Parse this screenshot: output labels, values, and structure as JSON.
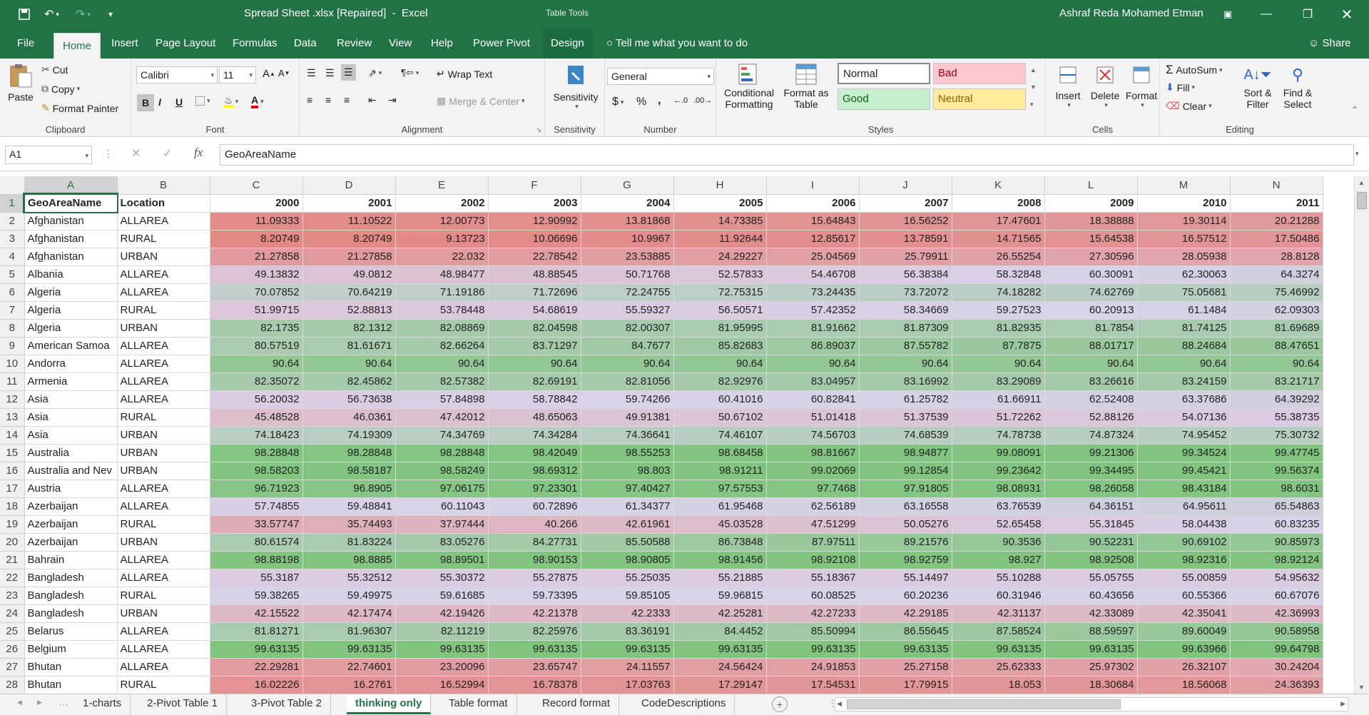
{
  "window": {
    "title": "Spread Sheet .xlsx [Repaired]  -  Excel",
    "contextual_label": "Table Tools",
    "user": "Ashraf Reda Mohamed Etman",
    "share": "Share",
    "tell_me": "Tell me what you want to do"
  },
  "ribbon_tabs": [
    "File",
    "Home",
    "Insert",
    "Page Layout",
    "Formulas",
    "Data",
    "Review",
    "View",
    "Help",
    "Power Pivot",
    "Design"
  ],
  "ribbon": {
    "clipboard": {
      "paste": "Paste",
      "cut": "Cut",
      "copy": "Copy",
      "format_painter": "Format Painter",
      "label": "Clipboard"
    },
    "font": {
      "name": "Calibri",
      "size": "11",
      "label": "Font",
      "bold": "B",
      "italic": "I",
      "underline": "U"
    },
    "alignment": {
      "wrap": "Wrap Text",
      "merge": "Merge & Center",
      "label": "Alignment"
    },
    "sensitivity": {
      "button": "Sensitivity",
      "label": "Sensitivity"
    },
    "number": {
      "format": "General",
      "label": "Number"
    },
    "styles": {
      "conditional": [
        "Conditional",
        "Formatting"
      ],
      "format_table": [
        "Format as",
        "Table"
      ],
      "normal": "Normal",
      "bad": "Bad",
      "good": "Good",
      "neutral": "Neutral",
      "label": "Styles"
    },
    "cells": {
      "insert": "Insert",
      "delete": "Delete",
      "format": "Format",
      "label": "Cells"
    },
    "editing": {
      "autosum": "AutoSum",
      "fill": "Fill",
      "clear": "Clear",
      "sort": [
        "Sort &",
        "Filter"
      ],
      "find": [
        "Find &",
        "Select"
      ],
      "label": "Editing"
    }
  },
  "formula_bar": {
    "name_box": "A1",
    "fx": "fx",
    "content": "GeoAreaName"
  },
  "columns": [
    "A",
    "B",
    "C",
    "D",
    "E",
    "F",
    "G",
    "H",
    "I",
    "J",
    "K",
    "L",
    "M",
    "N"
  ],
  "header_row": [
    "GeoAreaName",
    "Location",
    "2000",
    "2001",
    "2002",
    "2003",
    "2004",
    "2005",
    "2006",
    "2007",
    "2008",
    "2009",
    "2010",
    "2011"
  ],
  "rows": [
    [
      "Afghanistan",
      "ALLAREA",
      "11.09333",
      "11.10522",
      "12.00773",
      "12.90992",
      "13.81868",
      "14.73385",
      "15.64843",
      "16.56252",
      "17.47601",
      "18.38888",
      "19.30114",
      "20.21288"
    ],
    [
      "Afghanistan",
      "RURAL",
      "8.20749",
      "8.20749",
      "9.13723",
      "10.06696",
      "10.9967",
      "11.92644",
      "12.85617",
      "13.78591",
      "14.71565",
      "15.64538",
      "16.57512",
      "17.50486"
    ],
    [
      "Afghanistan",
      "URBAN",
      "21.27858",
      "21.27858",
      "22.032",
      "22.78542",
      "23.53885",
      "24.29227",
      "25.04569",
      "25.79911",
      "26.55254",
      "27.30596",
      "28.05938",
      "28.8128"
    ],
    [
      "Albania",
      "ALLAREA",
      "49.13832",
      "49.0812",
      "48.98477",
      "48.88545",
      "50.71768",
      "52.57833",
      "54.46708",
      "56.38384",
      "58.32848",
      "60.30091",
      "62.30063",
      "64.3274"
    ],
    [
      "Algeria",
      "ALLAREA",
      "70.07852",
      "70.64219",
      "71.19186",
      "71.72696",
      "72.24755",
      "72.75315",
      "73.24435",
      "73.72072",
      "74.18282",
      "74.62769",
      "75.05681",
      "75.46992"
    ],
    [
      "Algeria",
      "RURAL",
      "51.99715",
      "52.88813",
      "53.78448",
      "54.68619",
      "55.59327",
      "56.50571",
      "57.42352",
      "58.34669",
      "59.27523",
      "60.20913",
      "61.1484",
      "62.09303"
    ],
    [
      "Algeria",
      "URBAN",
      "82.1735",
      "82.1312",
      "82.08869",
      "82.04598",
      "82.00307",
      "81.95995",
      "81.91662",
      "81.87309",
      "81.82935",
      "81.7854",
      "81.74125",
      "81.69689"
    ],
    [
      "American Samoa",
      "ALLAREA",
      "80.57519",
      "81.61671",
      "82.66264",
      "83.71297",
      "84.7677",
      "85.82683",
      "86.89037",
      "87.55782",
      "87.7875",
      "88.01717",
      "88.24684",
      "88.47651"
    ],
    [
      "Andorra",
      "ALLAREA",
      "90.64",
      "90.64",
      "90.64",
      "90.64",
      "90.64",
      "90.64",
      "90.64",
      "90.64",
      "90.64",
      "90.64",
      "90.64",
      "90.64"
    ],
    [
      "Armenia",
      "ALLAREA",
      "82.35072",
      "82.45862",
      "82.57382",
      "82.69191",
      "82.81056",
      "82.92976",
      "83.04957",
      "83.16992",
      "83.29089",
      "83.26616",
      "83.24159",
      "83.21717"
    ],
    [
      "Asia",
      "ALLAREA",
      "56.20032",
      "56.73638",
      "57.84898",
      "58.78842",
      "59.74266",
      "60.41016",
      "60.82841",
      "61.25782",
      "61.66911",
      "62.52408",
      "63.37686",
      "64.39292"
    ],
    [
      "Asia",
      "RURAL",
      "45.48528",
      "46.0361",
      "47.42012",
      "48.65063",
      "49.91381",
      "50.67102",
      "51.01418",
      "51.37539",
      "51.72262",
      "52.88126",
      "54.07136",
      "55.38735"
    ],
    [
      "Asia",
      "URBAN",
      "74.18423",
      "74.19309",
      "74.34769",
      "74.34284",
      "74.36641",
      "74.46107",
      "74.56703",
      "74.68539",
      "74.78738",
      "74.87324",
      "74.95452",
      "75.30732"
    ],
    [
      "Australia",
      "URBAN",
      "98.28848",
      "98.28848",
      "98.28848",
      "98.42049",
      "98.55253",
      "98.68458",
      "98.81667",
      "98.94877",
      "99.08091",
      "99.21306",
      "99.34524",
      "99.47745"
    ],
    [
      "Australia and Nev",
      "URBAN",
      "98.58203",
      "98.58187",
      "98.58249",
      "98.69312",
      "98.803",
      "98.91211",
      "99.02069",
      "99.12854",
      "99.23642",
      "99.34495",
      "99.45421",
      "99.56374"
    ],
    [
      "Austria",
      "ALLAREA",
      "96.71923",
      "96.8905",
      "97.06175",
      "97.23301",
      "97.40427",
      "97.57553",
      "97.7468",
      "97.91805",
      "98.08931",
      "98.26058",
      "98.43184",
      "98.6031"
    ],
    [
      "Azerbaijan",
      "ALLAREA",
      "57.74855",
      "59.48841",
      "60.11043",
      "60.72896",
      "61.34377",
      "61.95468",
      "62.56189",
      "63.16558",
      "63.76539",
      "64.36151",
      "64.95611",
      "65.54863"
    ],
    [
      "Azerbaijan",
      "RURAL",
      "33.57747",
      "35.74493",
      "37.97444",
      "40.266",
      "42.61961",
      "45.03528",
      "47.51299",
      "50.05276",
      "52.65458",
      "55.31845",
      "58.04438",
      "60.83235"
    ],
    [
      "Azerbaijan",
      "URBAN",
      "80.61574",
      "81.83224",
      "83.05276",
      "84.27731",
      "85.50588",
      "86.73848",
      "87.97511",
      "89.21576",
      "90.3536",
      "90.52231",
      "90.69102",
      "90.85973"
    ],
    [
      "Bahrain",
      "ALLAREA",
      "98.88198",
      "98.8885",
      "98.89501",
      "98.90153",
      "98.90805",
      "98.91456",
      "98.92108",
      "98.92759",
      "98.927",
      "98.92508",
      "98.92316",
      "98.92124"
    ],
    [
      "Bangladesh",
      "ALLAREA",
      "55.3187",
      "55.32512",
      "55.30372",
      "55.27875",
      "55.25035",
      "55.21885",
      "55.18367",
      "55.14497",
      "55.10288",
      "55.05755",
      "55.00859",
      "54.95632"
    ],
    [
      "Bangladesh",
      "RURAL",
      "59.38265",
      "59.49975",
      "59.61685",
      "59.73395",
      "59.85105",
      "59.96815",
      "60.08525",
      "60.20236",
      "60.31946",
      "60.43656",
      "60.55366",
      "60.67076"
    ],
    [
      "Bangladesh",
      "URBAN",
      "42.15522",
      "42.17474",
      "42.19426",
      "42.21378",
      "42.2333",
      "42.25281",
      "42.27233",
      "42.29185",
      "42.31137",
      "42.33089",
      "42.35041",
      "42.36993"
    ],
    [
      "Belarus",
      "ALLAREA",
      "81.81271",
      "81.96307",
      "82.11219",
      "82.25976",
      "83.36191",
      "84.4452",
      "85.50994",
      "86.55645",
      "87.58524",
      "88.59597",
      "89.60049",
      "90.58958"
    ],
    [
      "Belgium",
      "ALLAREA",
      "99.63135",
      "99.63135",
      "99.63135",
      "99.63135",
      "99.63135",
      "99.63135",
      "99.63135",
      "99.63135",
      "99.63135",
      "99.63135",
      "99.63966",
      "99.64798"
    ],
    [
      "Bhutan",
      "ALLAREA",
      "22.29281",
      "22.74601",
      "23.20096",
      "23.65747",
      "24.11557",
      "24.56424",
      "24.91853",
      "25.27158",
      "25.62333",
      "25.97302",
      "26.32107",
      "30.24204"
    ],
    [
      "Bhutan",
      "RURAL",
      "16.02226",
      "16.2761",
      "16.52994",
      "16.78378",
      "17.03763",
      "17.29147",
      "17.54531",
      "17.79915",
      "18.053",
      "18.30684",
      "18.56068",
      "24.36393"
    ]
  ],
  "sheet_tabs": [
    "1-charts",
    "2-Pivot Table 1",
    "3-Pivot Table 2",
    "thinking only",
    "Table format",
    "Record format",
    "CodeDescriptions"
  ],
  "active_sheet": "thinking only",
  "colors": {
    "excel_green": "#217346",
    "scale_low": "#e67c73",
    "scale_mid": "#d9d2e9",
    "scale_high": "#7fc47d"
  }
}
